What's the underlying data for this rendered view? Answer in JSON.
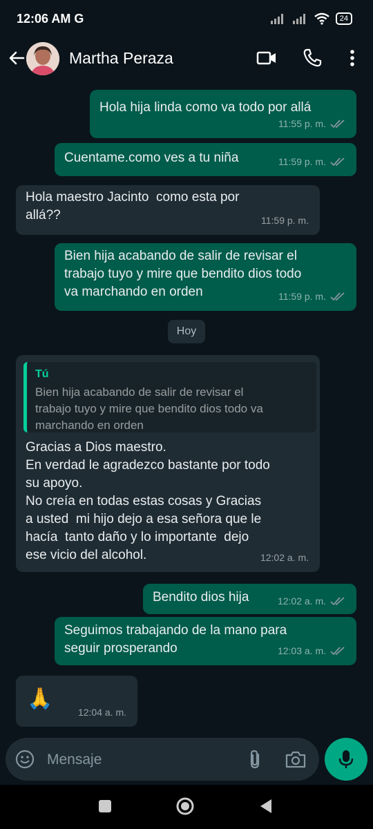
{
  "status_bar": {
    "time": "12:06 AM",
    "carrier_icon": "G",
    "battery": "24"
  },
  "header": {
    "contact_name": "Martha Peraza",
    "icons": [
      "back-arrow-icon",
      "avatar",
      "video-call-icon",
      "phone-icon",
      "more-vert-icon"
    ]
  },
  "messages": [
    {
      "dir": "out",
      "text": "Hola hija linda como va todo por allá",
      "time": "11:55 p. m.",
      "read": true
    },
    {
      "dir": "out",
      "text": "Cuentame.como ves a tu niña",
      "time": "11:59 p. m.",
      "read": true
    },
    {
      "dir": "in",
      "text": "Hola maestro Jacinto  como esta por\nallá??",
      "time": "11:59 p. m."
    },
    {
      "dir": "out",
      "text": "Bien hija acabando de salir de revisar el\ntrabajo tuyo y mire que bendito dios todo\nva marchando en orden",
      "time": "11:59 p. m.",
      "read": true
    },
    {
      "dir": "in",
      "quote_author": "Tú",
      "quote_text": "Bien hija acabando de salir de revisar el\ntrabajo tuyo y mire que bendito dios todo va\nmarchando en orden",
      "text": "Gracias a Dios maestro.\nEn verdad le agradezco bastante por todo\nsu apoyo.\nNo creía en todas estas cosas y Gracias\na usted  mi hijo dejo a esa señora que le\nhacía  tanto daño y lo importante  dejo\nese vicio del alcohol.",
      "time": "12:02 a. m."
    },
    {
      "dir": "out",
      "text": "Bendito dios hija",
      "time": "12:02 a. m.",
      "read": true
    },
    {
      "dir": "out",
      "text": "Seguimos trabajando de la mano para\nseguir prosperando",
      "time": "12:03 a. m.",
      "read": true
    },
    {
      "dir": "in",
      "text": "🙏",
      "time": "12:04 a. m."
    }
  ],
  "day_divider": "Hoy",
  "input": {
    "placeholder": "Mensaje"
  },
  "colors": {
    "outgoing_bubble": "#005c4b",
    "incoming_bubble": "#1f2c34",
    "background": "#0b141a",
    "accent": "#00a884",
    "read_ticks": "#8696a0"
  }
}
